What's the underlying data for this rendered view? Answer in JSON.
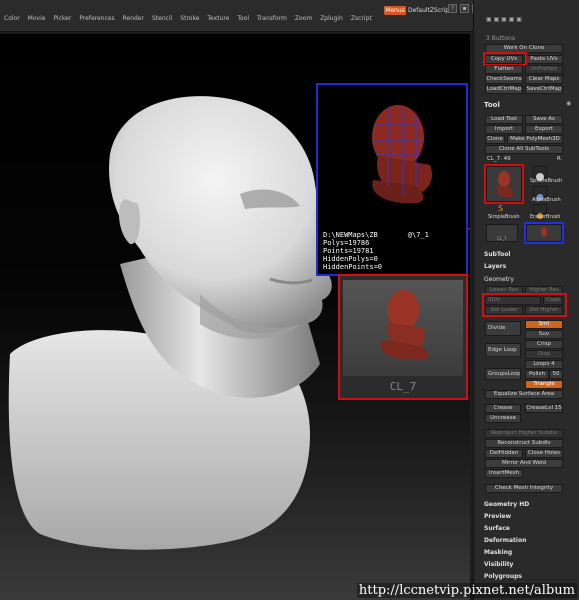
{
  "menu": {
    "items": [
      "Color",
      "Movie",
      "Picker",
      "Preferences",
      "Render",
      "Stencil",
      "Stroke",
      "Texture",
      "Tool",
      "Transform",
      "Zoom",
      "Zplugin",
      "Zscript"
    ],
    "menus_button": "Menus",
    "default_script": "DefaultZScript"
  },
  "popup": {
    "path": "D:\\NEWMaps\\ZB",
    "tag": "@\\7_1",
    "polys": "Polys=19786",
    "points": "Points=19781",
    "hidden_polys": "HiddenPolys=0",
    "hidden_points": "HiddenPoints=0"
  },
  "zoom_label": "CL_7",
  "panel": {
    "work_on_clone": "Work On Clone",
    "copy_uvs": "Copy UVs",
    "paste_uvs": "Paste UVs",
    "flatten": "Flatten",
    "unflatten": "UnFlatten",
    "check_seams": "CheckSeams",
    "clear_maps": "Clear Maps",
    "load_ctrl_map": "LoadCtrlMap",
    "save_ctrl_map": "SaveCtrlMap",
    "tool_title": "Tool",
    "load_tool": "Load Tool",
    "save_as": "Save As",
    "import": "Import",
    "export": "Export",
    "clone": "Clone",
    "make_polymesh": "Make PolyMesh3D",
    "clone_all": "Clone All SubTools",
    "cl_value": "CL_7. 49",
    "r": "R",
    "sphere_brush": "SphereBrush",
    "alpha_brush": "AlphaBrush",
    "simple_brush": "SimpleBrush",
    "eraser_brush": "EraserBrush",
    "cl7_thumb": "CL_7",
    "subtool": "SubTool",
    "layers": "Layers",
    "geometry": "Geometry",
    "lower_res": "Lower Res",
    "higher_res": "Higher Res",
    "sdiv": "SDiv",
    "cage": "Cage",
    "del_lower": "Del Lower",
    "del_higher": "Del Higher",
    "divide": "Divide",
    "smt": "Smt",
    "suv": "Suv",
    "edge_loop": "Edge Loop",
    "crisp": "Crisp",
    "disp": "Disp",
    "loops": "Loops 4",
    "groups_loops": "GroupsLoops",
    "polish": "Polish",
    "polish_val": "50",
    "triangle": "Triangle",
    "equalize": "Equalize Surface Area",
    "crease": "Crease",
    "crease_lvl": "CreaseLvl 15",
    "uncrease": "Uncrease",
    "reproject": "Reproject Higher Subdiv",
    "reconstruct": "Reconstruct Subdiv",
    "del_hidden": "DelHidden",
    "close_holes": "Close Holes",
    "mirror_weld": "Mirror And Weld",
    "insert_mesh": "InsertMesh",
    "check_mesh": "Check Mesh Integrity",
    "geometry_hd": "Geometry HD",
    "preview": "Preview",
    "surface": "Surface",
    "deformation": "Deformation",
    "masking": "Masking",
    "visibility": "Visibility",
    "polygroups": "Polygroups",
    "n_buttons": "3 Buttons"
  },
  "watermark": "http://lccnetvip.pixnet.net/album",
  "colors": {
    "accent": "#d0651e",
    "highlight_red": "#d01010",
    "highlight_blue": "#1f2bd8"
  }
}
